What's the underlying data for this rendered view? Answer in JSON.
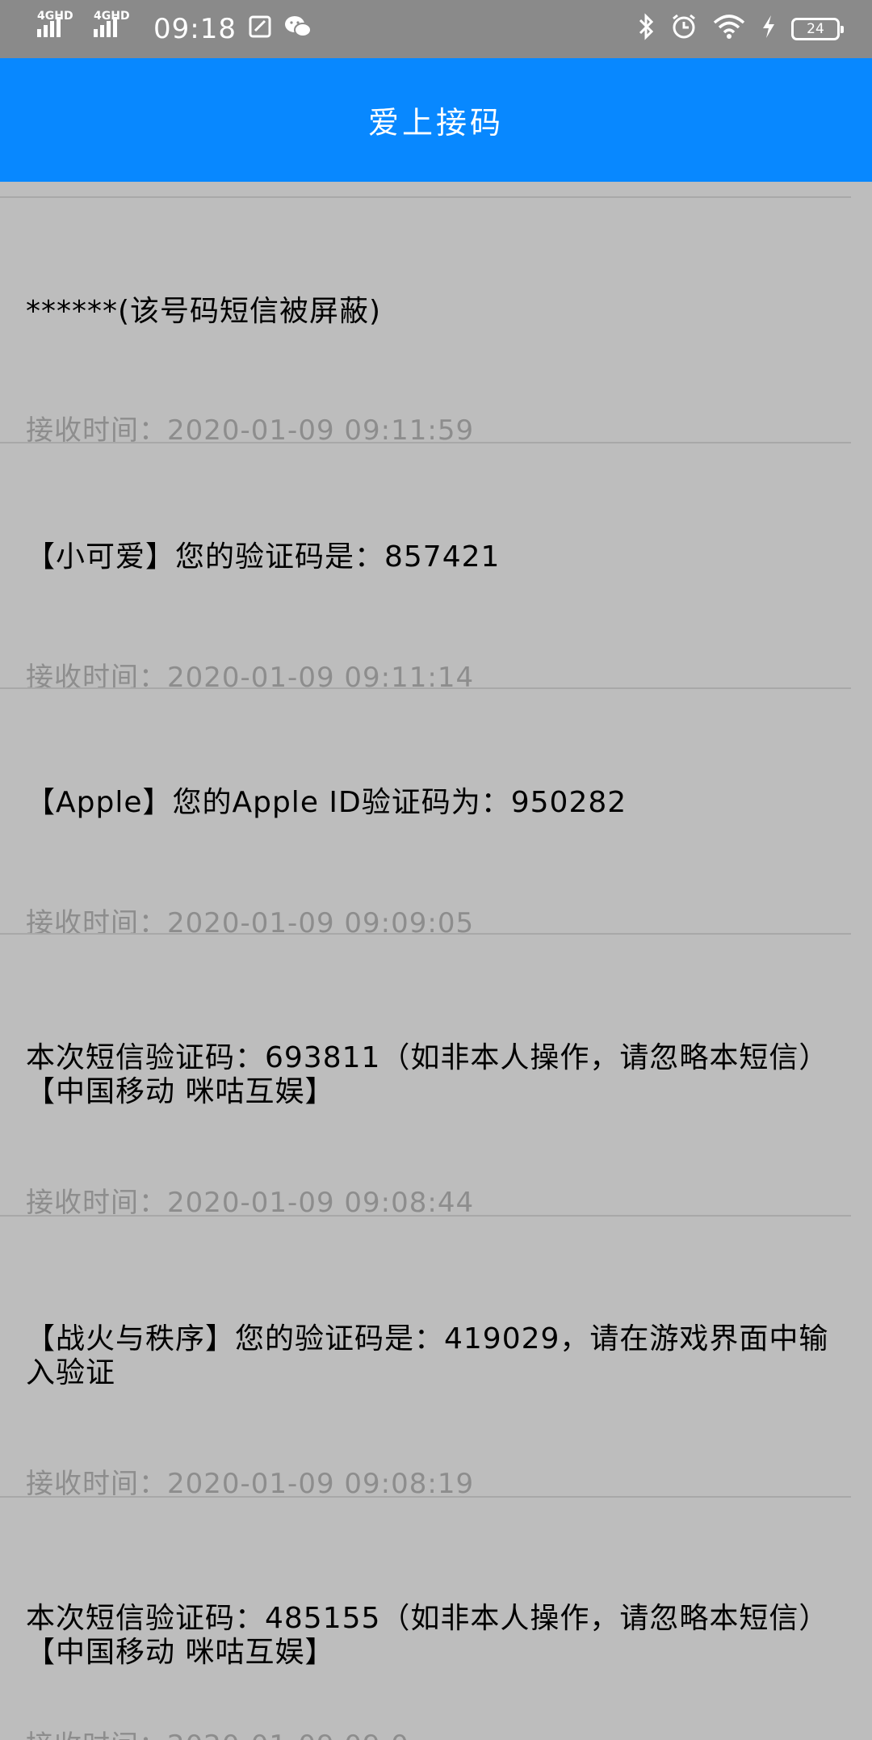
{
  "status_bar": {
    "net1": "4GHD",
    "net2": "4GHD",
    "time": "09:18",
    "battery": "24"
  },
  "app_bar": {
    "title": "爱上接码"
  },
  "messages": [
    {
      "text": "******(该号码短信被屏蔽)",
      "time_label": "接收时间：",
      "time": "2020-01-09 09:11:59"
    },
    {
      "text": "【小可爱】您的验证码是：857421",
      "time_label": "接收时间：",
      "time": "2020-01-09 09:11:14"
    },
    {
      "text": "【Apple】您的Apple ID验证码为：950282",
      "time_label": "接收时间：",
      "time": "2020-01-09 09:09:05"
    },
    {
      "text": "本次短信验证码：693811（如非本人操作，请忽略本短信）【中国移动  咪咕互娱】",
      "time_label": "接收时间：",
      "time": "2020-01-09 09:08:44"
    },
    {
      "text": "【战火与秩序】您的验证码是：419029，请在游戏界面中输入验证",
      "time_label": "接收时间：",
      "time": "2020-01-09 09:08:19"
    },
    {
      "text": "本次短信验证码：485155（如非本人操作，请忽略本短信）【中国移动  咪咕互娱】",
      "time_label": "接收时间：",
      "time": "2020-01-09 09:0"
    }
  ]
}
